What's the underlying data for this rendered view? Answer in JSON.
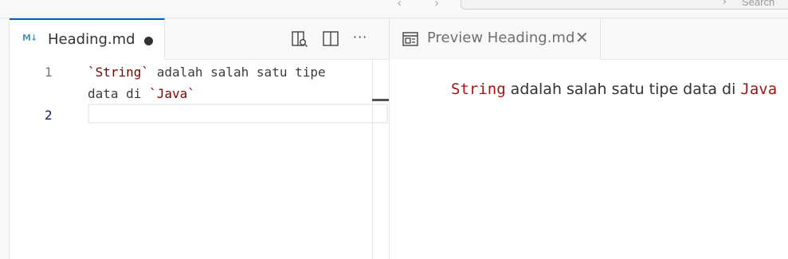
{
  "titlebar": {
    "back_glyph": "‹",
    "forward_glyph": "›",
    "search_label": "Search",
    "chevron_glyph": "›"
  },
  "editor": {
    "tab": {
      "label": "Heading.md",
      "icon": "markdown-icon",
      "icon_text": "M↓",
      "dirty": true
    },
    "actions": [
      "open-preview-to-side-icon",
      "split-editor-icon",
      "more-actions-icon"
    ],
    "more_glyph": "···",
    "lines": [
      {
        "number": "1",
        "segments": [
          "`String`",
          " adalah salah satu tipe"
        ]
      },
      {
        "number": "",
        "segments": [
          "data di ",
          "`Java`"
        ]
      },
      {
        "number": "2",
        "segments": [
          ""
        ]
      }
    ]
  },
  "preview": {
    "tab": {
      "label": "Preview Heading.md",
      "icon": "preview-icon",
      "close_glyph": "✕"
    },
    "content": {
      "code1": "String",
      "text1": " adalah salah satu tipe data di ",
      "code2": "Java"
    }
  },
  "colors": {
    "accent": "#005fb8",
    "code_text": "#a31515",
    "backtick_code": "#800000",
    "markdown_icon": "#519aba"
  }
}
